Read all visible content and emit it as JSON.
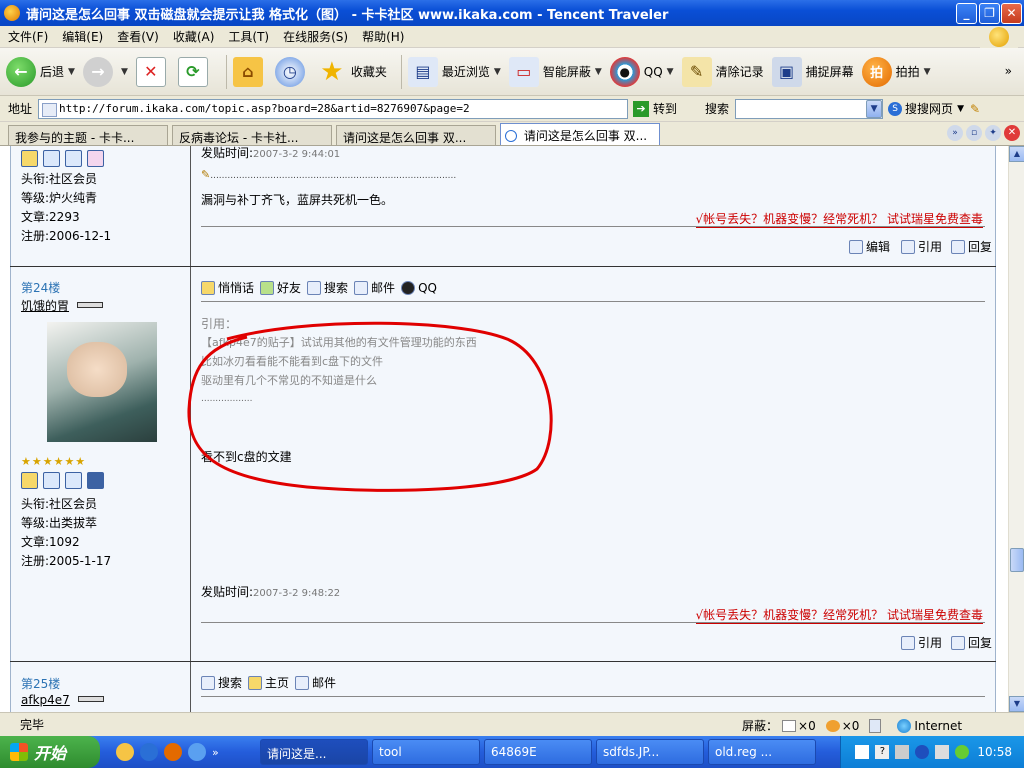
{
  "window": {
    "title": "请问这是怎么回事 双击磁盘就会提示让我 格式化（图） - 卡卡社区 www.ikaka.com - Tencent Traveler"
  },
  "menu": [
    "文件(F)",
    "编辑(E)",
    "查看(V)",
    "收藏(A)",
    "工具(T)",
    "在线服务(S)",
    "帮助(H)"
  ],
  "toolbar": {
    "back": "后退",
    "favorites": "收藏夹",
    "recent": "最近浏览",
    "smartblock": "智能屏蔽",
    "qq": "QQ",
    "clear": "清除记录",
    "capture": "捕捉屏幕",
    "paipai": "拍拍",
    "more": "»"
  },
  "addressbar": {
    "label": "地址",
    "url": "http://forum.ikaka.com/topic.asp?board=28&artid=8276907&page=2",
    "go": "转到",
    "search_label": "搜索",
    "search_web": "搜搜网页"
  },
  "tabs": [
    {
      "label": "我参与的主题 - 卡卡..."
    },
    {
      "label": "反病毒论坛 - 卡卡社..."
    },
    {
      "label": "请问这是怎么回事 双..."
    },
    {
      "label": "请问这是怎么回事 双..."
    }
  ],
  "posts": {
    "p23": {
      "title": "头衔:社区会员",
      "level": "等级:炉火纯青",
      "articles": "文章:2293",
      "registered": "注册:2006-12-1",
      "time_label": "发贴时间:",
      "time": "2007-3-2 9:44:01",
      "dots": "......................................................................................",
      "body": "漏洞与补丁齐飞，蓝屏共死机一色。",
      "ad": "√帐号丢失？机器变慢？经常死机？ 试试瑞星免费查毒",
      "edit": "编辑",
      "quote": "引用",
      "reply": "回复"
    },
    "p24": {
      "floor": "第24楼",
      "user": "饥饿的胃",
      "stars": "★★★★★★",
      "title": "头衔:社区会员",
      "level": "等级:出类拔萃",
      "articles": "文章:1092",
      "registered": "注册:2005-1-17",
      "actions": [
        "悄悄话",
        "好友",
        "搜索",
        "邮件",
        "QQ"
      ],
      "quote_label": "引用：",
      "quote_lines": [
        "【afkp4e7的贴子】试试用其他的有文件管理功能的东西",
        "比如冰刃看看能不能看到c盘下的文件",
        "驱动里有几个不常见的不知道是什么",
        ".................."
      ],
      "body": "看不到c盘的文建",
      "time_label": "发贴时间:",
      "time": "2007-3-2 9:48:22",
      "ad": "√帐号丢失？机器变慢？经常死机？ 试试瑞星免费查毒",
      "quote": "引用",
      "reply": "回复"
    },
    "p25": {
      "floor": "第25楼",
      "user": "afkp4e7",
      "actions": [
        "搜索",
        "主页",
        "邮件"
      ]
    }
  },
  "statusbar": {
    "status": "完毕",
    "block_label": "屏蔽：",
    "block1": "×0",
    "block2": "×0",
    "zone": "Internet"
  },
  "taskbar": {
    "start": "开始",
    "tasks": [
      "请问这是...",
      "tool",
      "64869E",
      "sdfds.JP...",
      "old.reg ..."
    ],
    "clock": "10:58"
  },
  "colors": {
    "title_blue": "#0a4fd6",
    "link_blue": "#2c73b4",
    "ad_red": "#cc0000",
    "circle_red": "#e00000"
  }
}
